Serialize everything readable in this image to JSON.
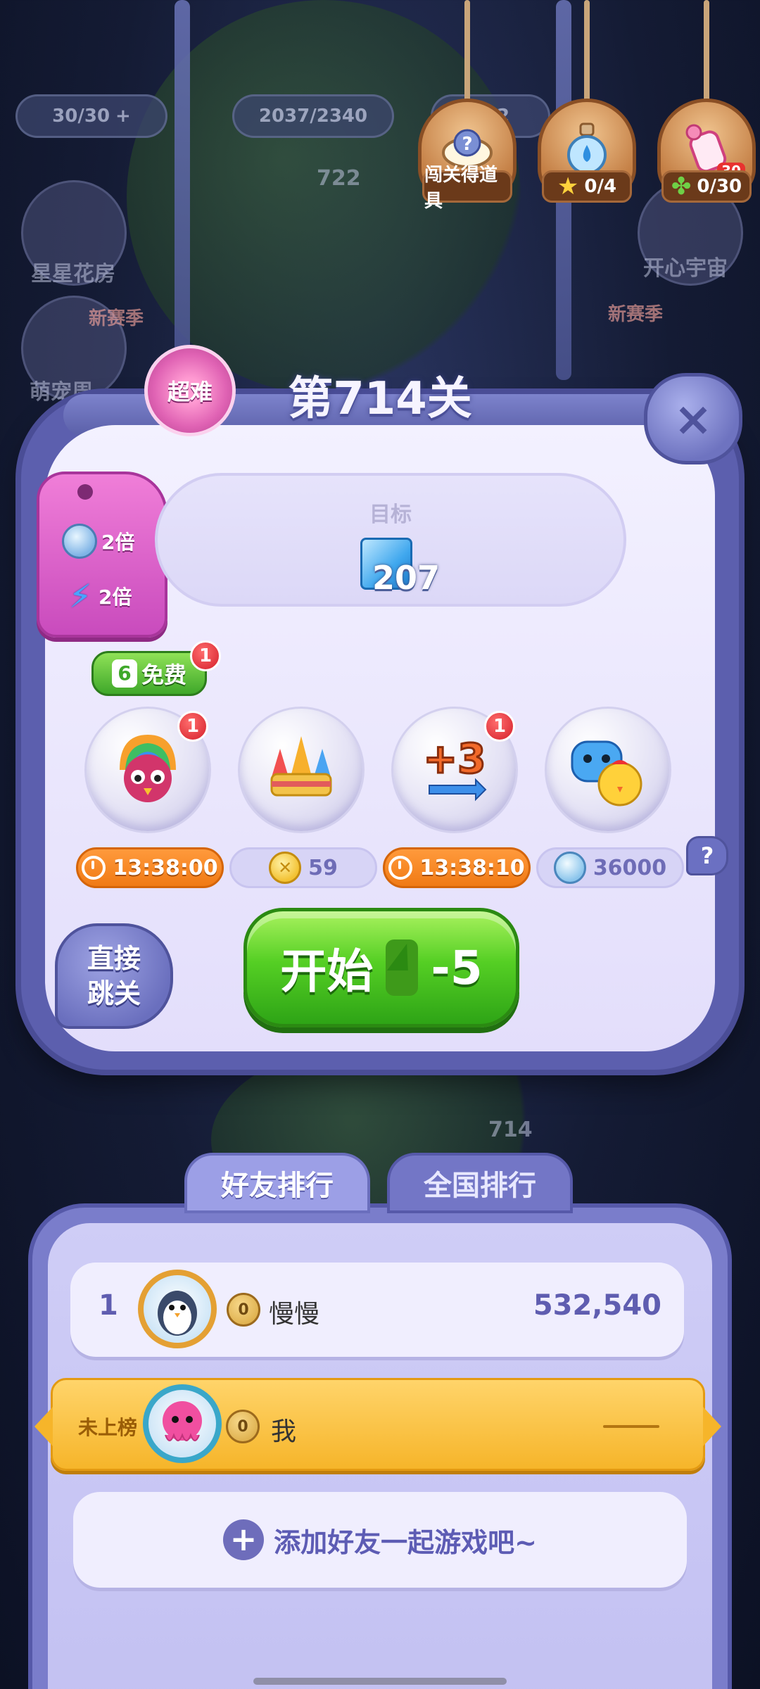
{
  "background": {
    "energy": "30/30",
    "energy_plus": "+",
    "stars_progress": "2037/2340",
    "coins_partial": "652",
    "map_level_722": "722",
    "map_level_714": "714",
    "left_items": [
      "星星花房",
      "萌宠周"
    ],
    "right_items": [
      "开心宇宙"
    ],
    "new_season": "新赛季",
    "new_season_right": "新赛季"
  },
  "hanging_tags": {
    "reward_label": "闯关得道具",
    "stars_count": "0/4",
    "clover_count": "0/30",
    "bottle_badge": "30"
  },
  "dialog": {
    "difficulty": "超难",
    "level_title": "第714关",
    "close_symbol": "×",
    "bonus": {
      "coin_multiplier": "2倍",
      "energy_multiplier": "2倍"
    },
    "goal": {
      "label": "目标",
      "count": "207"
    },
    "free_button": {
      "icon": "6",
      "label": "免费",
      "badge": "1"
    },
    "boosters": [
      {
        "name": "rainbow-bird",
        "badge": "1",
        "price_type": "timer",
        "price": "13:38:00"
      },
      {
        "name": "rockets",
        "badge": "",
        "price_type": "gold",
        "price": "59"
      },
      {
        "name": "plus-three-moves",
        "badge": "1",
        "price_type": "timer",
        "price": "13:38:10",
        "glyph": "+3"
      },
      {
        "name": "pets",
        "badge": "",
        "price_type": "silver",
        "price": "36000"
      }
    ],
    "help_symbol": "?",
    "skip_label_line1": "直接",
    "skip_label_line2": "跳关",
    "start_label": "开始",
    "start_cost": "-5"
  },
  "leaderboard": {
    "tabs": [
      "好友排行",
      "全国排行"
    ],
    "entries": [
      {
        "rank": "1",
        "level_badge": "0",
        "name": "慢慢",
        "score": "532,540"
      }
    ],
    "me": {
      "status": "未上榜",
      "level_badge": "0",
      "name": "我"
    },
    "add_friend_label": "添加好友一起游戏吧~",
    "add_symbol": "+"
  }
}
